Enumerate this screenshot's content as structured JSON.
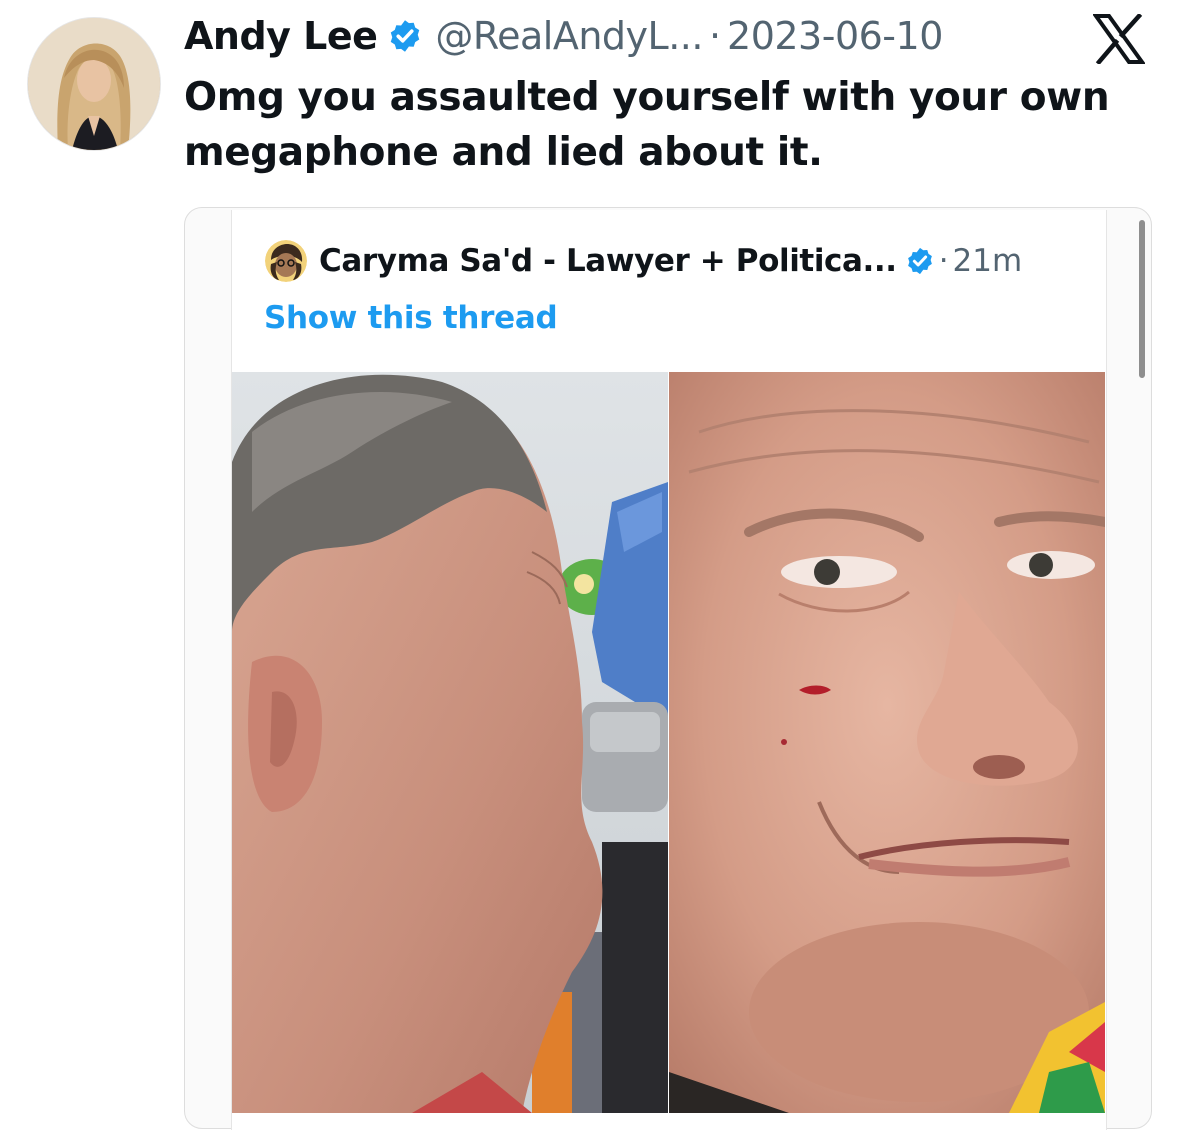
{
  "tweet": {
    "display_name": "Andy Lee",
    "handle": "@RealAndyL...",
    "separator": "·",
    "date": "2023-06-10",
    "text": "Omg you assaulted yourself with your own megaphone and lied about it.",
    "verified": true,
    "platform_icon": "x-logo-icon"
  },
  "quoted_tweet": {
    "display_name": "Caryma Sa'd - Lawyer + Politica...",
    "separator": "·",
    "time": "21m",
    "verified": true,
    "show_thread_label": "Show this thread",
    "images": [
      "left-photo",
      "right-photo"
    ]
  },
  "colors": {
    "accent_blue": "#1d9bf0",
    "muted_text": "#536471",
    "primary_text": "#0f1419"
  }
}
